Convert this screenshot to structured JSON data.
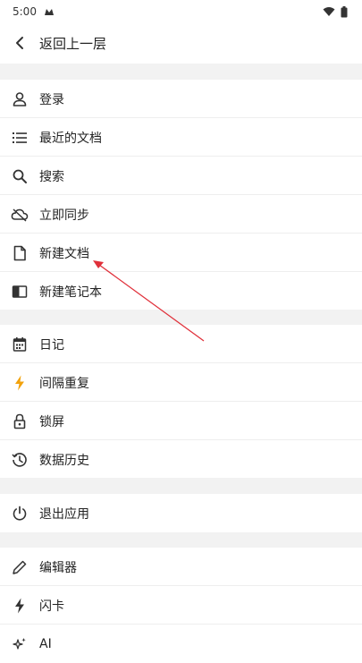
{
  "status": {
    "time": "5:00"
  },
  "header": {
    "back_label": "返回上一层"
  },
  "menu": {
    "group1": [
      {
        "label": "登录",
        "icon": "user-icon"
      },
      {
        "label": "最近的文档",
        "icon": "list-icon"
      },
      {
        "label": "搜索",
        "icon": "search-icon"
      },
      {
        "label": "立即同步",
        "icon": "cloud-sync-icon"
      },
      {
        "label": "新建文档",
        "icon": "file-icon"
      },
      {
        "label": "新建笔记本",
        "icon": "notebook-icon"
      }
    ],
    "group2": [
      {
        "label": "日记",
        "icon": "calendar-icon"
      },
      {
        "label": "间隔重复",
        "icon": "bolt-icon"
      },
      {
        "label": "锁屏",
        "icon": "lock-icon"
      },
      {
        "label": "数据历史",
        "icon": "history-icon"
      }
    ],
    "group3": [
      {
        "label": "退出应用",
        "icon": "power-icon"
      }
    ],
    "group4": [
      {
        "label": "编辑器",
        "icon": "pen-icon"
      },
      {
        "label": "闪卡",
        "icon": "flashcard-bolt-icon"
      },
      {
        "label": "AI",
        "icon": "sparkle-icon"
      }
    ]
  },
  "colors": {
    "accent_bolt": "#f2a20c",
    "annotation_arrow": "#e0303a"
  }
}
